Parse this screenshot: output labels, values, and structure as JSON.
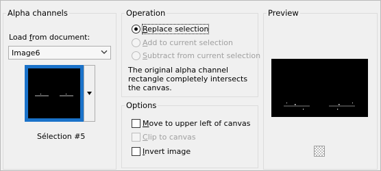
{
  "alpha_channels": {
    "title": "Alpha channels",
    "load_label_pre": "Load ",
    "load_label_u": "f",
    "load_label_post": "rom document:",
    "document_value": "Image6",
    "selection_caption": "Sélection #5"
  },
  "operation": {
    "title": "Operation",
    "replace_u": "R",
    "replace_rest": "eplace selection",
    "add_u": "A",
    "add_rest": "dd to current selection",
    "subtract_u": "S",
    "subtract_rest": "ubtract from current selection",
    "description": "The original alpha channel rectangle completely intersects the canvas."
  },
  "options": {
    "title": "Options",
    "move_u": "M",
    "move_rest": "ove to upper left of canvas",
    "clip_u": "C",
    "clip_rest": "lip to canvas",
    "invert_u": "I",
    "invert_rest": "nvert image"
  },
  "preview": {
    "title": "Preview"
  },
  "icons": {
    "dropdown": "chevron-down-icon",
    "thumb_menu": "triangle-down-icon",
    "background": "checkerboard-icon"
  },
  "colors": {
    "selection_border": "#1a72c9",
    "preview_bg": "#000000"
  }
}
